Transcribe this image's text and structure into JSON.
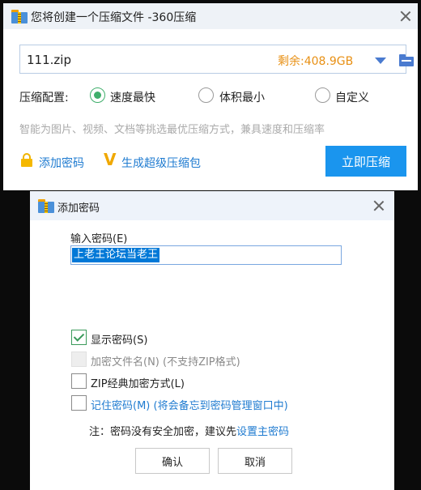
{
  "compress_window": {
    "title": "您将创建一个压缩文件 -360压缩",
    "filename": "111.zip",
    "free_space": "剩余:408.9GB",
    "config_label": "压缩配置:",
    "options": [
      {
        "label": "速度最快",
        "selected": true
      },
      {
        "label": "体积最小",
        "selected": false
      },
      {
        "label": "自定义",
        "selected": false
      }
    ],
    "hint": "智能为图片、视频、文档等挑选最优压缩方式，兼具速度和压缩率",
    "add_password_link": "添加密码",
    "super_package_link": "生成超级压缩包",
    "compress_button": "立即压缩"
  },
  "password_dialog": {
    "title": "添加密码",
    "input_label": "输入密码(E)",
    "input_value": "上老王论坛当老王",
    "checkboxes": [
      {
        "label": "显示密码(S)",
        "checked": true,
        "enabled": true
      },
      {
        "label": "加密文件名(N) (不支持ZIP格式)",
        "checked": false,
        "enabled": false
      },
      {
        "label": "ZIP经典加密方式(L)",
        "checked": false,
        "enabled": true
      },
      {
        "label": "记住密码(M) (将会备忘到密码管理窗口中)",
        "checked": false,
        "enabled": true
      }
    ],
    "note_prefix": "注：密码没有安全加密，建议先",
    "note_link": "设置主密码",
    "ok_button": "确认",
    "cancel_button": "取消"
  },
  "colors": {
    "accent_blue": "#1a95ee",
    "link_blue": "#1f7bd0",
    "free_space_orange": "#e89014",
    "radio_green": "#3fae6b"
  }
}
